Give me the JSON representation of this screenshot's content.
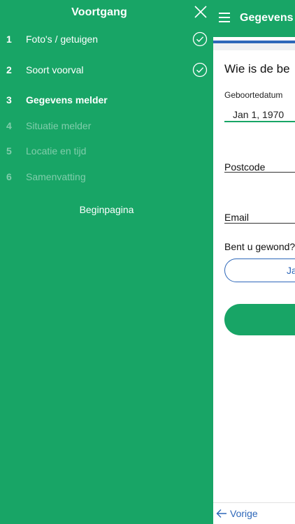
{
  "drawer": {
    "title": "Voortgang",
    "steps": [
      {
        "num": "1",
        "label": "Foto's / getuigen",
        "state": "done"
      },
      {
        "num": "2",
        "label": "Soort voorval",
        "state": "done"
      },
      {
        "num": "3",
        "label": "Gegevens melder",
        "state": "current"
      },
      {
        "num": "4",
        "label": "Situatie melder",
        "state": "todo"
      },
      {
        "num": "5",
        "label": "Locatie en tijd",
        "state": "todo"
      },
      {
        "num": "6",
        "label": "Samenvatting",
        "state": "todo"
      }
    ],
    "home_link": "Beginpagina"
  },
  "main": {
    "topbar_title": "Gegevens",
    "question": "Wie is de be",
    "birthdate_label": "Geboortedatum",
    "birthdate_value": "Jan 1, 1970",
    "postcode_label": "Postcode",
    "email_label": "Email",
    "injured_question": "Bent u gewond?",
    "yes_label": "Ja",
    "prev_label": "Vorige"
  },
  "colors": {
    "brand_green": "#18a566",
    "accent_blue": "#2d67b9"
  }
}
